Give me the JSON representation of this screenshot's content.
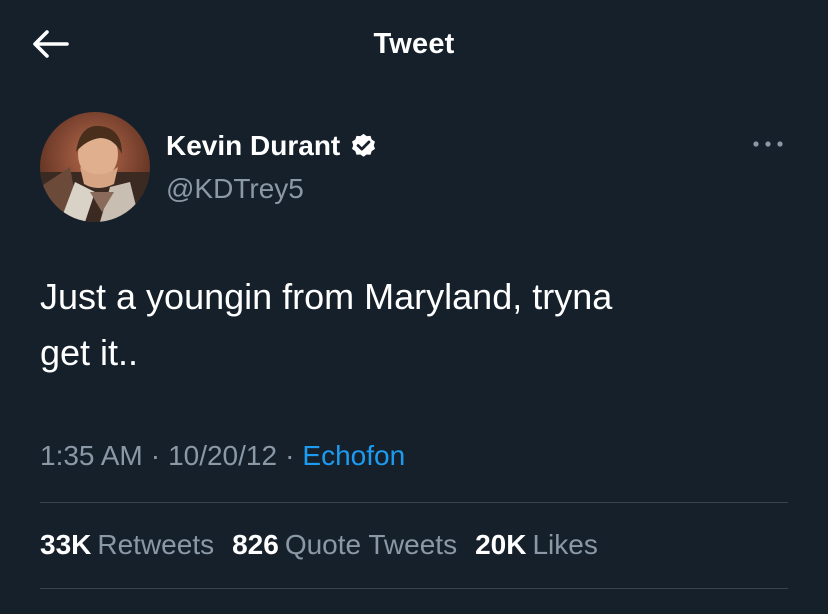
{
  "header": {
    "title": "Tweet",
    "back_icon": "arrow-left-icon"
  },
  "author": {
    "display_name": "Kevin Durant",
    "handle": "@KDTrey5",
    "verified_icon": "verified-badge-icon",
    "more_icon": "more-dots-icon"
  },
  "tweet": {
    "text": "Just a youngin from Maryland, tryna\nget it.."
  },
  "meta": {
    "time": "1:35 AM",
    "separator": "·",
    "date": "10/20/12",
    "source": "Echofon"
  },
  "stats": [
    {
      "count": "33K",
      "label": "Retweets"
    },
    {
      "count": "826",
      "label": "Quote Tweets"
    },
    {
      "count": "20K",
      "label": "Likes"
    }
  ],
  "colors": {
    "background": "#15202b",
    "text_primary": "#ffffff",
    "text_secondary": "#8b98a5",
    "accent": "#1d9bf0",
    "divider": "#38444d"
  }
}
